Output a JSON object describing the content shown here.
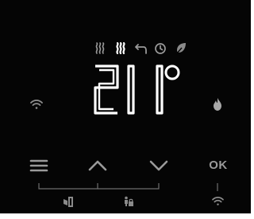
{
  "display": {
    "temperature_value": "21",
    "temperature_unit": "°"
  },
  "status_icons": [
    "heating-wave-icon",
    "heating-wave-bold-icon",
    "arrow-return-icon",
    "clock-icon",
    "leaf-icon"
  ],
  "side_indicators": {
    "left": "wifi-icon",
    "right": "flame-icon"
  },
  "buttons": {
    "ok_label": "OK",
    "menu": "menu-icon",
    "up": "chevron-up-icon",
    "down": "chevron-down-icon"
  },
  "combo_hints": [
    "window-open-icon",
    "child-lock-icon",
    "wifi-pairing-icon"
  ],
  "colors": {
    "background": "#050505",
    "display": "#ffffff",
    "controls": "#9a9a9a",
    "dim": "#8e8e8e"
  }
}
